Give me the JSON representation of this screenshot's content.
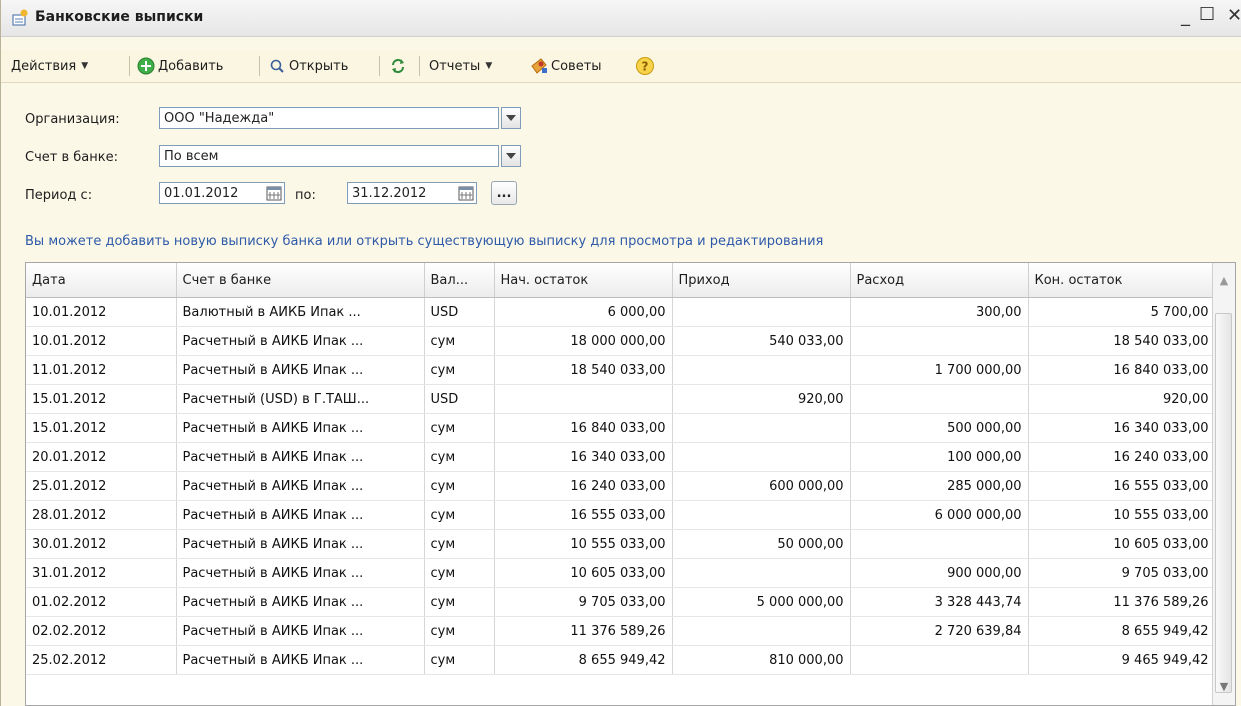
{
  "window": {
    "title": "Банковские выписки"
  },
  "toolbar": {
    "actions_label": "Действия",
    "add_label": "Добавить",
    "open_label": "Открыть",
    "reports_label": "Отчеты",
    "tips_label": "Советы"
  },
  "form": {
    "org_label": "Организация:",
    "org_value": "ООО \"Надежда\"",
    "account_label": "Счет в банке:",
    "account_value": "По всем",
    "period_label": "Период с:",
    "period_from": "01.01.2012",
    "period_to_label": "по:",
    "period_to": "31.12.2012",
    "dots_label": "..."
  },
  "info_text": "Вы можете добавить новую выписку банка или открыть существующую выписку для просмотра и редактирования",
  "table": {
    "columns": [
      "Дата",
      "Счет в банке",
      "Вал...",
      "Нач. остаток",
      "Приход",
      "Расход",
      "Кон. остаток"
    ],
    "rows": [
      [
        "10.01.2012",
        "Валютный в АИКБ Ипак ...",
        "USD",
        "6 000,00",
        "",
        "300,00",
        "5 700,00"
      ],
      [
        "10.01.2012",
        "Расчетный в АИКБ Ипак ...",
        "сум",
        "18 000 000,00",
        "540 033,00",
        "",
        "18 540 033,00"
      ],
      [
        "11.01.2012",
        "Расчетный в АИКБ Ипак ...",
        "сум",
        "18 540 033,00",
        "",
        "1 700 000,00",
        "16 840 033,00"
      ],
      [
        "15.01.2012",
        "Расчетный (USD) в Г.ТАШ...",
        "USD",
        "",
        "920,00",
        "",
        "920,00"
      ],
      [
        "15.01.2012",
        "Расчетный в АИКБ Ипак ...",
        "сум",
        "16 840 033,00",
        "",
        "500 000,00",
        "16 340 033,00"
      ],
      [
        "20.01.2012",
        "Расчетный в АИКБ Ипак ...",
        "сум",
        "16 340 033,00",
        "",
        "100 000,00",
        "16 240 033,00"
      ],
      [
        "25.01.2012",
        "Расчетный в АИКБ Ипак ...",
        "сум",
        "16 240 033,00",
        "600 000,00",
        "285 000,00",
        "16 555 033,00"
      ],
      [
        "28.01.2012",
        "Расчетный в АИКБ Ипак ...",
        "сум",
        "16 555 033,00",
        "",
        "6 000 000,00",
        "10 555 033,00"
      ],
      [
        "30.01.2012",
        "Расчетный в АИКБ Ипак ...",
        "сум",
        "10 555 033,00",
        "50 000,00",
        "",
        "10 605 033,00"
      ],
      [
        "31.01.2012",
        "Расчетный в АИКБ Ипак ...",
        "сум",
        "10 605 033,00",
        "",
        "900 000,00",
        "9 705 033,00"
      ],
      [
        "01.02.2012",
        "Расчетный в АИКБ Ипак ...",
        "сум",
        "9 705 033,00",
        "5 000 000,00",
        "3 328 443,74",
        "11 376 589,26"
      ],
      [
        "02.02.2012",
        "Расчетный в АИКБ Ипак ...",
        "сум",
        "11 376 589,26",
        "",
        "2 720 639,84",
        "8 655 949,42"
      ],
      [
        "25.02.2012",
        "Расчетный в АИКБ Ипак ...",
        "сум",
        "8 655 949,42",
        "810 000,00",
        "",
        "9 465 949,42"
      ]
    ]
  },
  "icons": [
    "window-app-icon",
    "add-icon",
    "search-icon",
    "refresh-icon",
    "tips-icon",
    "help-icon",
    "calendar-icon",
    "dropdown-arrow-icon"
  ]
}
